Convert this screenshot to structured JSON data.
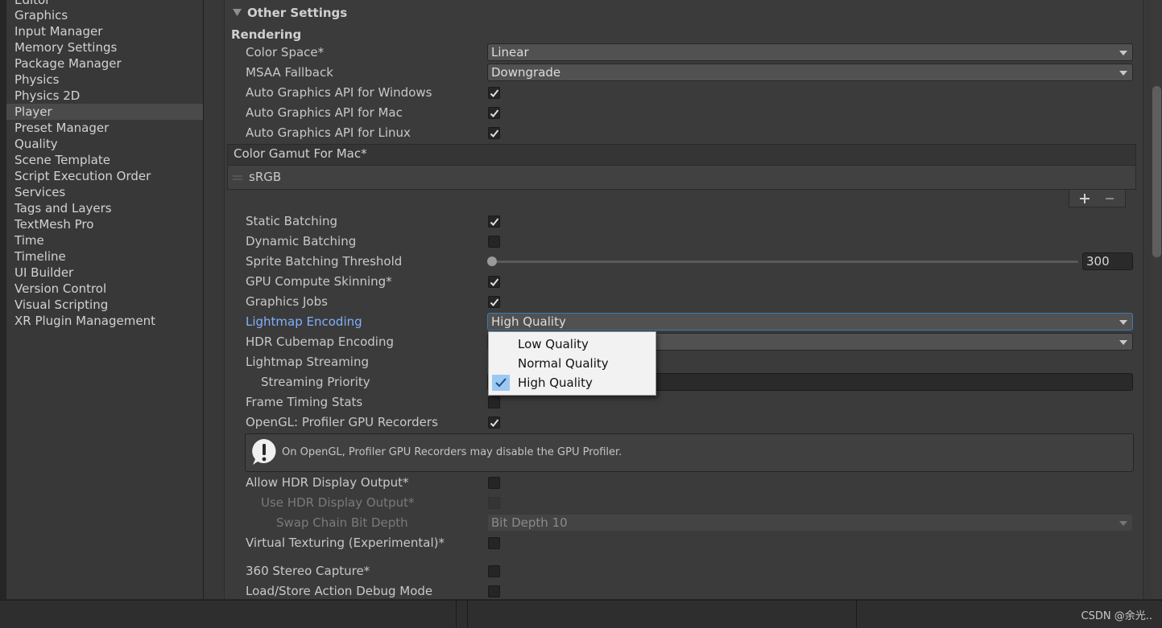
{
  "sidebar": {
    "items": [
      {
        "label": "Editor"
      },
      {
        "label": "Graphics"
      },
      {
        "label": "Input Manager"
      },
      {
        "label": "Memory Settings"
      },
      {
        "label": "Package Manager"
      },
      {
        "label": "Physics"
      },
      {
        "label": "Physics 2D"
      },
      {
        "label": "Player",
        "selected": true
      },
      {
        "label": "Preset Manager"
      },
      {
        "label": "Quality"
      },
      {
        "label": "Scene Template"
      },
      {
        "label": "Script Execution Order"
      },
      {
        "label": "Services"
      },
      {
        "label": "Tags and Layers"
      },
      {
        "label": "TextMesh Pro"
      },
      {
        "label": "Time"
      },
      {
        "label": "Timeline"
      },
      {
        "label": "UI Builder"
      },
      {
        "label": "Version Control"
      },
      {
        "label": "Visual Scripting"
      },
      {
        "label": "XR Plugin Management"
      }
    ]
  },
  "other_settings": {
    "title": "Other Settings",
    "rendering_header": "Rendering",
    "color_space": {
      "label": "Color Space*",
      "value": "Linear"
    },
    "msaa_fallback": {
      "label": "MSAA Fallback",
      "value": "Downgrade"
    },
    "auto_api_windows": {
      "label": "Auto Graphics API  for Windows",
      "checked": true
    },
    "auto_api_mac": {
      "label": "Auto Graphics API  for Mac",
      "checked": true
    },
    "auto_api_linux": {
      "label": "Auto Graphics API  for Linux",
      "checked": true
    },
    "color_gamut": {
      "header": "Color Gamut For Mac*",
      "items": [
        "sRGB"
      ]
    },
    "static_batching": {
      "label": "Static Batching",
      "checked": true
    },
    "dynamic_batching": {
      "label": "Dynamic Batching",
      "checked": false
    },
    "sprite_batching_threshold": {
      "label": "Sprite Batching Threshold",
      "value": "300"
    },
    "gpu_compute_skinning": {
      "label": "GPU Compute Skinning*",
      "checked": true
    },
    "graphics_jobs": {
      "label": "Graphics Jobs",
      "checked": true
    },
    "lightmap_encoding": {
      "label": "Lightmap Encoding",
      "value": "High Quality"
    },
    "hdr_cubemap_encoding": {
      "label": "HDR Cubemap Encoding"
    },
    "lightmap_streaming": {
      "label": "Lightmap Streaming"
    },
    "streaming_priority": {
      "label": "Streaming Priority"
    },
    "frame_timing_stats": {
      "label": "Frame Timing Stats",
      "checked": false
    },
    "opengl_profiler": {
      "label": "OpenGL: Profiler GPU Recorders",
      "checked": true
    },
    "warning": {
      "text": "On OpenGL, Profiler GPU Recorders may disable the GPU Profiler."
    },
    "allow_hdr_output": {
      "label": "Allow HDR Display Output*",
      "checked": false
    },
    "use_hdr_output": {
      "label": "Use HDR Display Output*",
      "checked": false
    },
    "swap_chain_bit_depth": {
      "label": "Swap Chain Bit Depth",
      "value": "Bit Depth 10"
    },
    "virtual_texturing": {
      "label": "Virtual Texturing (Experimental)*",
      "checked": false
    },
    "stereo_capture": {
      "label": "360 Stereo Capture*",
      "checked": false
    },
    "load_store_debug": {
      "label": "Load/Store Action Debug Mode",
      "checked": false
    }
  },
  "popup_menu": {
    "options": [
      {
        "label": "Low Quality",
        "selected": false
      },
      {
        "label": "Normal Quality",
        "selected": false
      },
      {
        "label": "High Quality",
        "selected": true
      }
    ]
  },
  "footer": {
    "credit": "CSDN @余光.."
  }
}
